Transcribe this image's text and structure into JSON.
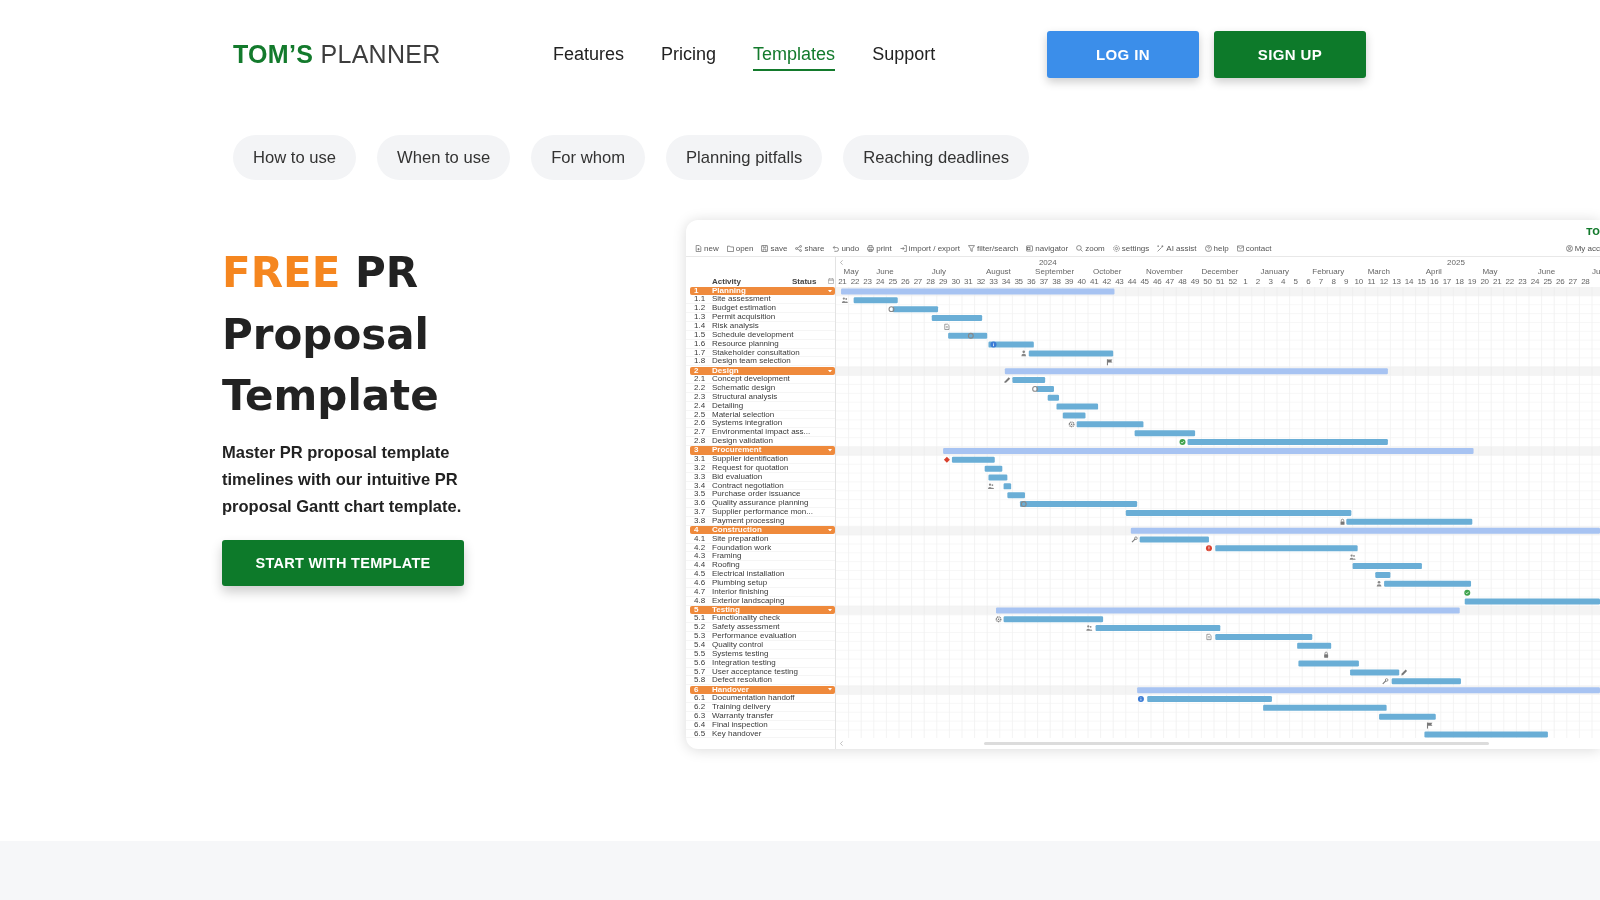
{
  "header": {
    "logo": "**TOM’S** PLANNER",
    "nav": [
      {
        "label": "Features",
        "selected": false
      },
      {
        "label": "Pricing",
        "selected": false
      },
      {
        "label": "Templates",
        "selected": true
      },
      {
        "label": "Support",
        "selected": false
      }
    ],
    "buttons": [
      {
        "label": "LOG IN",
        "kind": "secondary"
      },
      {
        "label": "SIGN UP",
        "kind": "primary"
      }
    ]
  },
  "section_links": [
    "How to use",
    "When to use",
    "For whom",
    "Planning pitfalls",
    "Reaching deadlines"
  ],
  "hero": {
    "title": {
      "highlight": "FREE",
      "text": "PR Proposal Template"
    },
    "description": "Master PR proposal template timelines with our intuitive PR proposal Gantt chart template.",
    "button": "START WITH TEMPLATE"
  },
  "gantt": {
    "brand": "TO",
    "toolbar": [
      "new",
      "open",
      "save",
      "share",
      "undo",
      "print",
      "import / export",
      "filter/search",
      "navigator",
      "zoom",
      "settings",
      "AI assist",
      "help",
      "contact"
    ],
    "account": "My acc",
    "years": [
      "2024",
      "2025"
    ],
    "months": [
      "May",
      "June",
      "July",
      "August",
      "September",
      "October",
      "November",
      "December",
      "January",
      "February",
      "March",
      "April",
      "May",
      "June",
      "Ju"
    ],
    "weeks": [
      "21",
      "22",
      "23",
      "24",
      "25",
      "26",
      "27",
      "28",
      "29",
      "30",
      "31",
      "32",
      "33",
      "34",
      "35",
      "36",
      "37",
      "38",
      "39",
      "40",
      "41",
      "42",
      "43",
      "44",
      "45",
      "46",
      "47",
      "48",
      "49",
      "50",
      "51",
      "52",
      "1",
      "2",
      "3",
      "4",
      "5",
      "6",
      "7",
      "8",
      "9",
      "10",
      "11",
      "12",
      "13",
      "14",
      "15",
      "16",
      "17",
      "18",
      "19",
      "20",
      "21",
      "22",
      "23",
      "24",
      "25",
      "26",
      "27",
      "28"
    ],
    "columns": [
      "Activity",
      "Status"
    ],
    "groups": [
      {
        "number": "1",
        "name": "Planning",
        "expanded": true,
        "children": [
          {
            "number": "1.1",
            "name": "Site assessment"
          },
          {
            "number": "1.2",
            "name": "Budget estimation"
          },
          {
            "number": "1.3",
            "name": "Permit acquisition"
          },
          {
            "number": "1.4",
            "name": "Risk analysis"
          },
          {
            "number": "1.5",
            "name": "Schedule development"
          },
          {
            "number": "1.6",
            "name": "Resource planning"
          },
          {
            "number": "1.7",
            "name": "Stakeholder consultation"
          },
          {
            "number": "1.8",
            "name": "Design team selection"
          }
        ]
      },
      {
        "number": "2",
        "name": "Design",
        "expanded": true,
        "children": [
          {
            "number": "2.1",
            "name": "Concept development"
          },
          {
            "number": "2.2",
            "name": "Schematic design"
          },
          {
            "number": "2.3",
            "name": "Structural analysis"
          },
          {
            "number": "2.4",
            "name": "Detailing"
          },
          {
            "number": "2.5",
            "name": "Material selection"
          },
          {
            "number": "2.6",
            "name": "Systems integration"
          },
          {
            "number": "2.7",
            "name": "Environmental impact ass..."
          },
          {
            "number": "2.8",
            "name": "Design validation"
          }
        ]
      },
      {
        "number": "3",
        "name": "Procurement",
        "expanded": true,
        "children": [
          {
            "number": "3.1",
            "name": "Supplier identification"
          },
          {
            "number": "3.2",
            "name": "Request for quotation"
          },
          {
            "number": "3.3",
            "name": "Bid evaluation"
          },
          {
            "number": "3.4",
            "name": "Contract negotiation"
          },
          {
            "number": "3.5",
            "name": "Purchase order issuance"
          },
          {
            "number": "3.6",
            "name": "Quality assurance planning"
          },
          {
            "number": "3.7",
            "name": "Supplier performance mon..."
          },
          {
            "number": "3.8",
            "name": "Payment processing"
          }
        ]
      },
      {
        "number": "4",
        "name": "Construction",
        "expanded": true,
        "children": [
          {
            "number": "4.1",
            "name": "Site preparation"
          },
          {
            "number": "4.2",
            "name": "Foundation work"
          },
          {
            "number": "4.3",
            "name": "Framing"
          },
          {
            "number": "4.4",
            "name": "Roofing"
          },
          {
            "number": "4.5",
            "name": "Electrical installation"
          },
          {
            "number": "4.6",
            "name": "Plumbing setup"
          },
          {
            "number": "4.7",
            "name": "Interior finishing"
          },
          {
            "number": "4.8",
            "name": "Exterior landscaping"
          }
        ]
      },
      {
        "number": "5",
        "name": "Testing",
        "expanded": true,
        "children": [
          {
            "number": "5.1",
            "name": "Functionality check"
          },
          {
            "number": "5.2",
            "name": "Safety assessment"
          },
          {
            "number": "5.3",
            "name": "Performance evaluation"
          },
          {
            "number": "5.4",
            "name": "Quality control"
          },
          {
            "number": "5.5",
            "name": "Systems testing"
          },
          {
            "number": "5.6",
            "name": "Integration testing"
          },
          {
            "number": "5.7",
            "name": "User acceptance testing"
          },
          {
            "number": "5.8",
            "name": "Defect resolution"
          }
        ]
      },
      {
        "number": "6",
        "name": "Handover",
        "expanded": true,
        "children": [
          {
            "number": "6.1",
            "name": "Documentation handoff"
          },
          {
            "number": "6.2",
            "name": "Training delivery"
          },
          {
            "number": "6.3",
            "name": "Warranty transfer"
          },
          {
            "number": "6.4",
            "name": "Final inspection"
          },
          {
            "number": "6.5",
            "name": "Key handover"
          }
        ]
      }
    ]
  }
}
